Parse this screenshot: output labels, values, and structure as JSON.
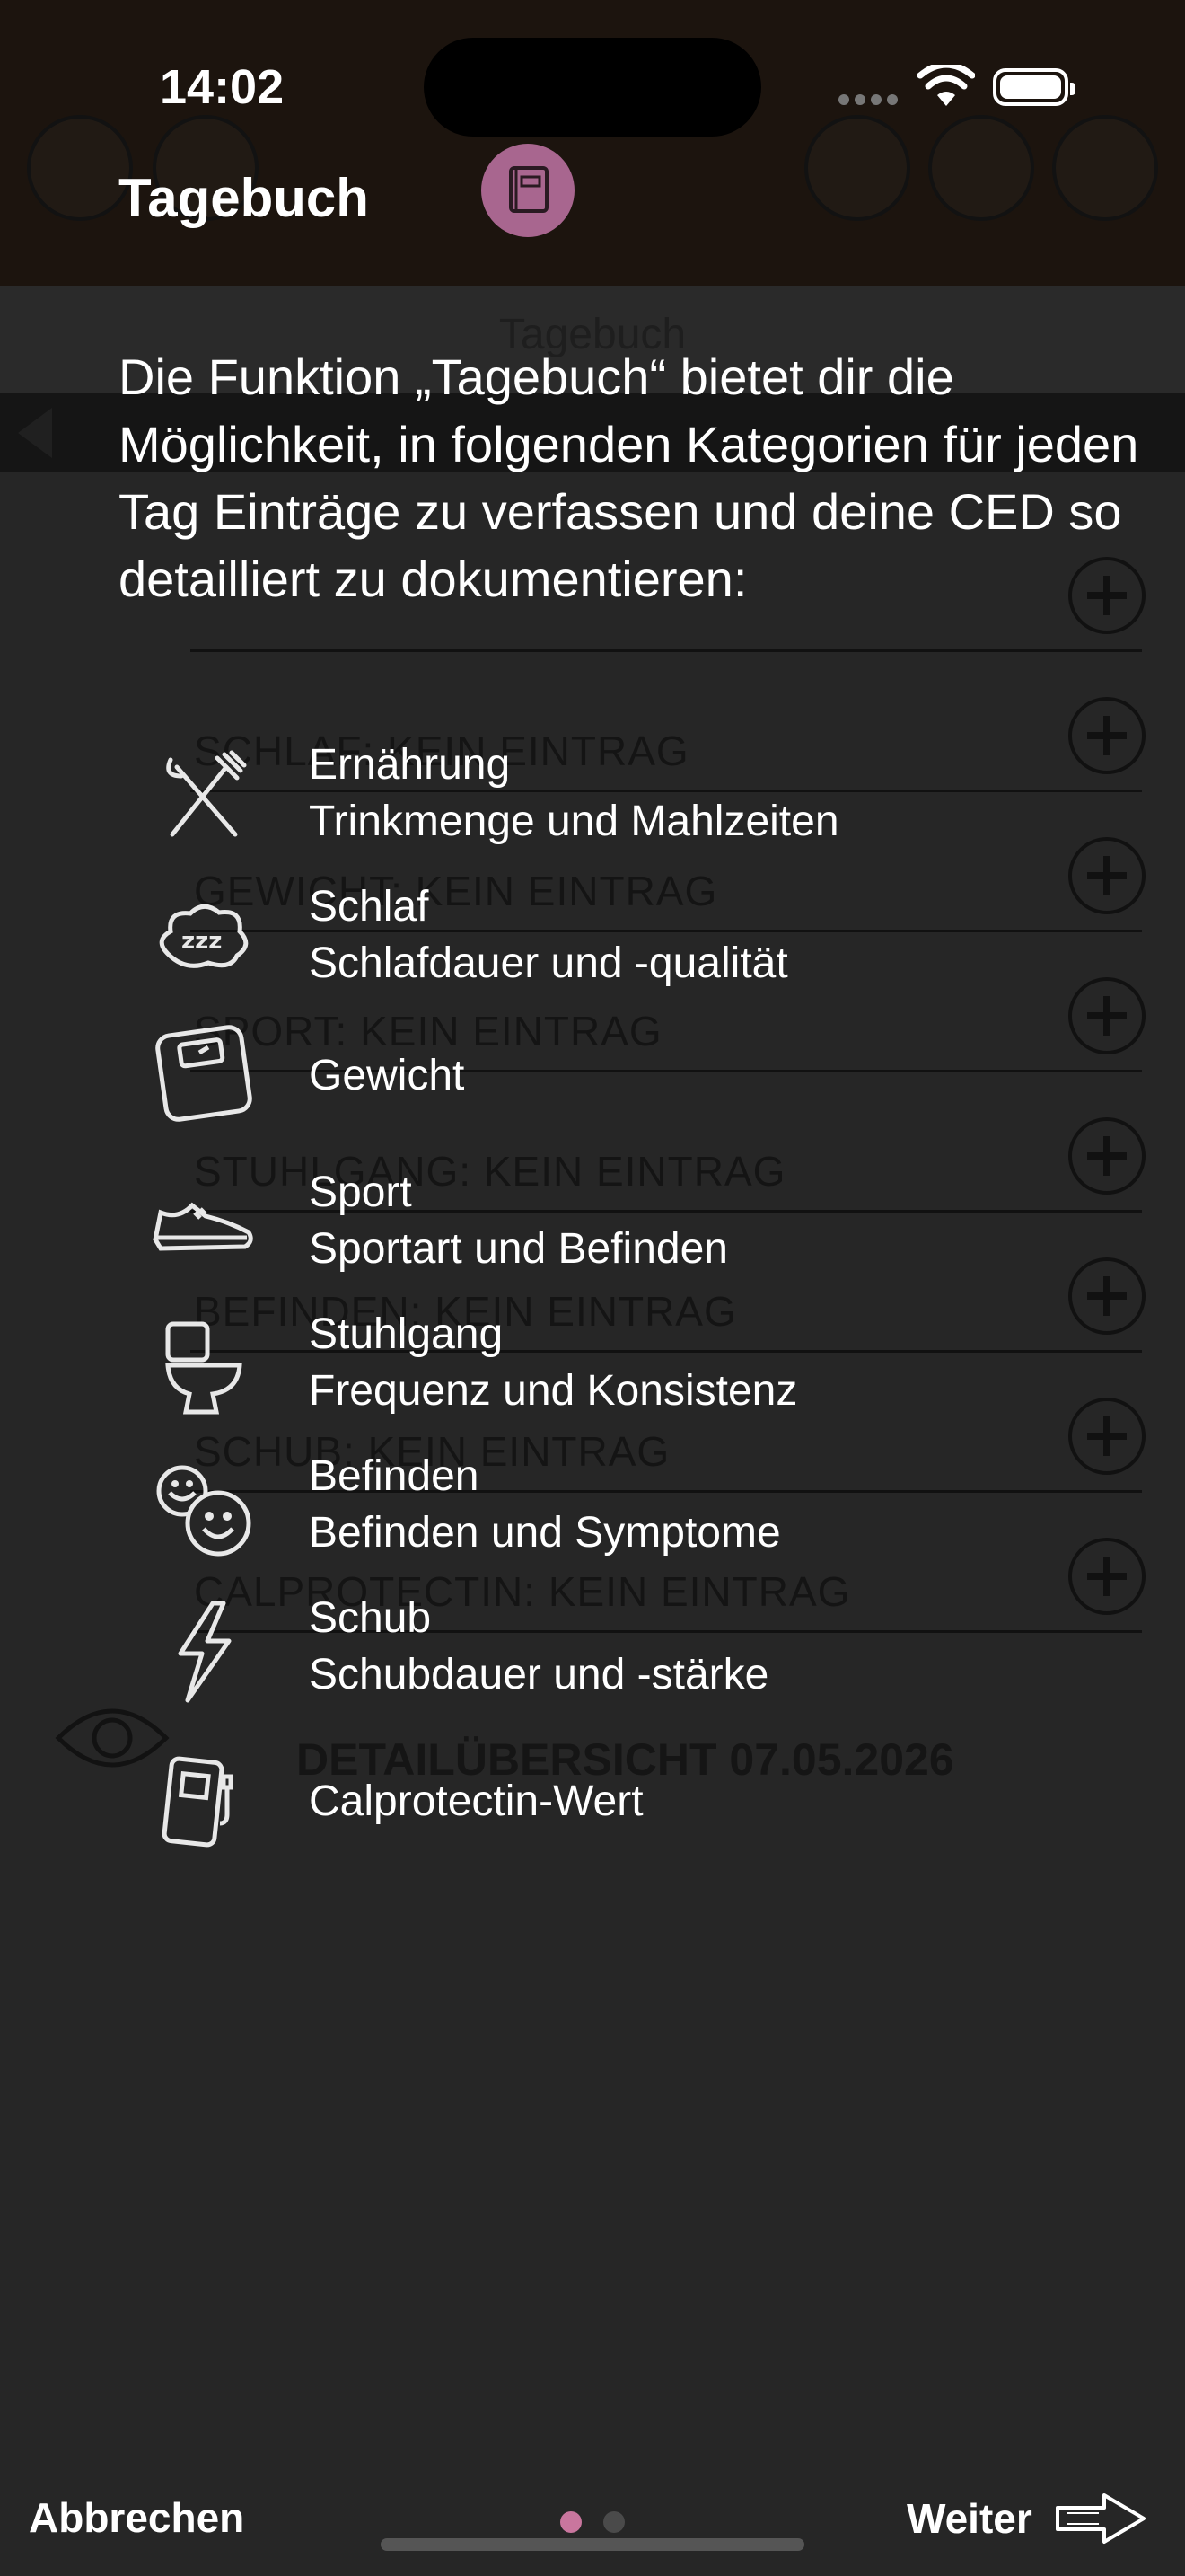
{
  "status_bar": {
    "time": "14:02"
  },
  "background": {
    "title": "Tagebuch",
    "rows": [
      "SCHLAF: KEIN EINTRAG",
      "GEWICHT: KEIN EINTRAG",
      "SPORT: KEIN EINTRAG",
      "STUHLGANG: KEIN EINTRAG",
      "BEFINDEN: KEIN EINTRAG",
      "SCHUB: KEIN EINTRAG",
      "CALPROTECTIN: KEIN EINTRAG"
    ],
    "detail": "DETAILÜBERSICHT 07.05.2026"
  },
  "overlay": {
    "title": "Tagebuch",
    "intro": "Die Funktion „Tagebuch“ bietet dir die Möglichkeit, in folgenden Kategorien für jeden Tag Einträge zu verfassen und deine CED so detailliert zu dokumentieren:",
    "categories": [
      {
        "name": "Ernährung",
        "desc": "Trinkmenge und Mahlzeiten",
        "icon": "fork-knife-icon"
      },
      {
        "name": "Schlaf",
        "desc": "Schlafdauer und -qualität",
        "icon": "sleep-cloud-icon"
      },
      {
        "name": "Gewicht",
        "desc": "",
        "icon": "scale-icon"
      },
      {
        "name": "Sport",
        "desc": "Sportart und Befinden",
        "icon": "sneaker-icon"
      },
      {
        "name": "Stuhlgang",
        "desc": "Frequenz und Konsistenz",
        "icon": "toilet-icon"
      },
      {
        "name": "Befinden",
        "desc": "Befinden und Symptome",
        "icon": "smiley-icon"
      },
      {
        "name": "Schub",
        "desc": "Schubdauer und -stärke",
        "icon": "lightning-icon"
      },
      {
        "name": "Calprotectin-Wert",
        "desc": "",
        "icon": "test-device-icon"
      }
    ]
  },
  "footer": {
    "cancel_label": "Abbrechen",
    "next_label": "Weiter"
  },
  "pager": {
    "current": 1,
    "total": 2
  },
  "colors": {
    "accent": "#c9769e",
    "badge": "#a8668f",
    "topbar": "#1c140e",
    "overlay_bg": "#262626"
  }
}
